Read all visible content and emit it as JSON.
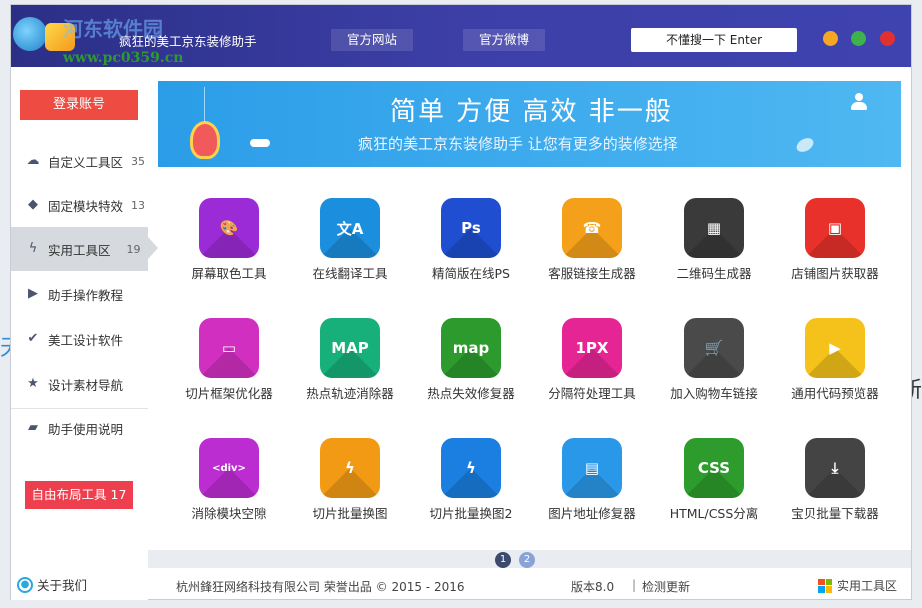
{
  "app": {
    "watermark_site": "河东软件园",
    "watermark_url": "www.pc0359.cn",
    "title": "疯狂的美工京东装修助手"
  },
  "header": {
    "official_site": "官方网站",
    "official_weibo": "官方微博",
    "search_button": "不懂搜一下 Enter"
  },
  "sidebar": {
    "login": "登录账号",
    "items": [
      {
        "label": "自定义工具区",
        "count": "35",
        "icon": "cloud-icon"
      },
      {
        "label": "固定模块特效",
        "count": "13",
        "icon": "cube-icon"
      },
      {
        "label": "实用工具区",
        "count": "19",
        "icon": "lightning-icon",
        "active": true
      },
      {
        "label": "助手操作教程",
        "count": "",
        "icon": "play-icon"
      },
      {
        "label": "美工设计软件",
        "count": "",
        "icon": "cloud-check-icon"
      },
      {
        "label": "设计素材导航",
        "count": "",
        "icon": "star-icon"
      },
      {
        "label": "助手使用说明",
        "count": "",
        "icon": "book-icon"
      }
    ],
    "free_layout": "自由布局工具 17",
    "about": "关于我们"
  },
  "banner": {
    "headline": "简单 方便 高效 非一般",
    "subtitle": "疯狂的美工京东装修助手 让您有更多的装修选择"
  },
  "tools": [
    {
      "label": "屏幕取色工具",
      "glyph": "🎨",
      "color": "#9b2bd6",
      "icon": "palette-icon"
    },
    {
      "label": "在线翻译工具",
      "glyph": "文A",
      "color": "#1b8fde",
      "icon": "translate-icon"
    },
    {
      "label": "精简版在线PS",
      "glyph": "Ps",
      "color": "#1f4fd0",
      "icon": "photoshop-icon"
    },
    {
      "label": "客服链接生成器",
      "glyph": "☎",
      "color": "#f5a01a",
      "icon": "headset-icon"
    },
    {
      "label": "二维码生成器",
      "glyph": "▦",
      "color": "#3a3a3a",
      "icon": "qrcode-icon"
    },
    {
      "label": "店铺图片获取器",
      "glyph": "▣",
      "color": "#e8312a",
      "icon": "image-download-icon"
    },
    {
      "label": "切片框架优化器",
      "glyph": "▭",
      "color": "#d12fbf",
      "icon": "frame-icon"
    },
    {
      "label": "热点轨迹消除器",
      "glyph": "MAP",
      "color": "#18b07a",
      "icon": "map-icon"
    },
    {
      "label": "热点失效修复器",
      "glyph": "map",
      "color": "#2c9a2c",
      "icon": "map-pin-icon"
    },
    {
      "label": "分隔符处理工具",
      "glyph": "1PX",
      "color": "#e62595",
      "icon": "separator-icon"
    },
    {
      "label": "加入购物车链接",
      "glyph": "🛒",
      "color": "#4a4a4a",
      "icon": "cart-icon"
    },
    {
      "label": "通用代码预览器",
      "glyph": "▶",
      "color": "#f4c21a",
      "icon": "code-preview-icon"
    },
    {
      "label": "消除模块空隙",
      "glyph": "<div>",
      "color": "#bb2dd1",
      "icon": "div-icon"
    },
    {
      "label": "切片批量换图",
      "glyph": "ϟ",
      "color": "#f39a14",
      "icon": "slice-icon"
    },
    {
      "label": "切片批量换图2",
      "glyph": "ϟ",
      "color": "#1a7fe0",
      "icon": "slice2-icon"
    },
    {
      "label": "图片地址修复器",
      "glyph": "▤",
      "color": "#2a98e8",
      "icon": "image-url-icon"
    },
    {
      "label": "HTML/CSS分离",
      "glyph": "CSS",
      "color": "#2d9c2d",
      "icon": "css-html-icon"
    },
    {
      "label": "宝贝批量下载器",
      "glyph": "⤓",
      "color": "#444444",
      "icon": "batch-download-icon"
    }
  ],
  "pager": [
    "1",
    "2"
  ],
  "footer": {
    "copyright": "杭州鋒狂网络科技有限公司 荣誉出品 © 2015 - 2016",
    "version": "版本8.0",
    "separator": "|",
    "check_update": "检测更新",
    "section": "实用工具区"
  }
}
